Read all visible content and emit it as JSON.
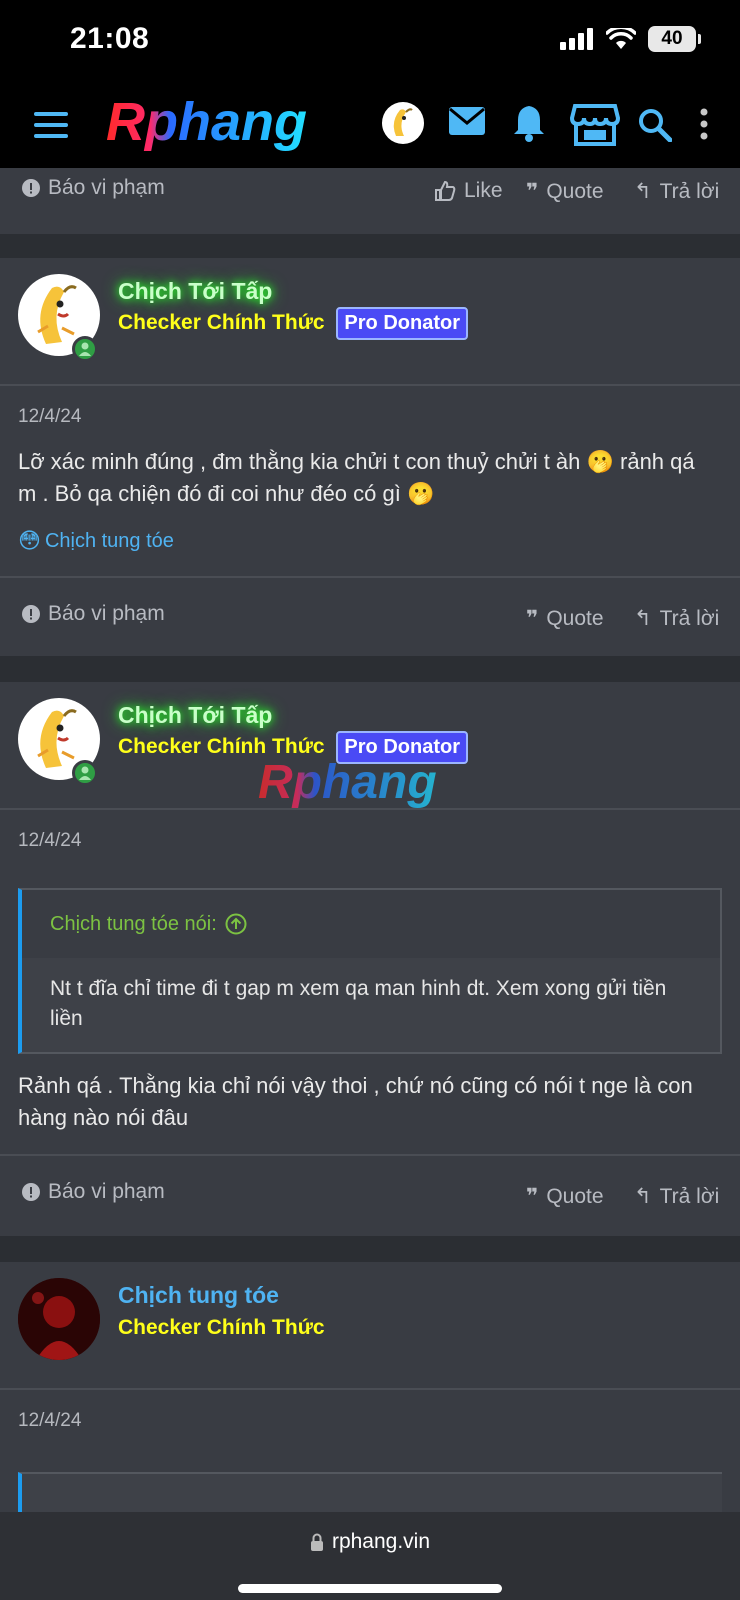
{
  "status_bar": {
    "time": "21:08",
    "battery": "40"
  },
  "nav": {
    "logo": "Rphang"
  },
  "top_footer": {
    "report": "Báo vi phạm",
    "like": "Like",
    "quote": "Quote",
    "reply": "Trả lời"
  },
  "posts": [
    {
      "username": "Chịch Tới Tấp",
      "title": "Checker Chính Thức",
      "badge": "Pro Donator",
      "date": "12/4/24",
      "text": "Lỡ xác minh đúng , đm thằng kia chửi t con thuỷ chửi t àh 🫢 rảnh qá m . Bỏ qa chiện đó đi coi như đéo có gì 🫢",
      "reaction_user": "Chịch tung tóe",
      "reaction_emoji": "😳",
      "footer": {
        "report": "Báo vi phạm",
        "quote": "Quote",
        "reply": "Trả lời"
      }
    },
    {
      "username": "Chịch Tới Tấp",
      "title": "Checker Chính Thức",
      "badge": "Pro Donator",
      "date": "12/4/24",
      "quote_author": "Chịch tung tóe nói:",
      "quote_text": "Nt t đĩa chỉ time đi t gap m xem qa man hinh dt. Xem xong gửi tiền liền",
      "text": "Rảnh qá . Thằng kia chỉ nói vậy thoi , chứ nó cũng có nói t nge là con hàng nào nói đâu",
      "footer": {
        "report": "Báo vi phạm",
        "quote": "Quote",
        "reply": "Trả lời"
      }
    },
    {
      "username": "Chịch tung tóe",
      "title": "Checker Chính Thức",
      "date": "12/4/24"
    }
  ],
  "watermark": "Rphang",
  "url_bar": {
    "url": "rphang.vin"
  }
}
